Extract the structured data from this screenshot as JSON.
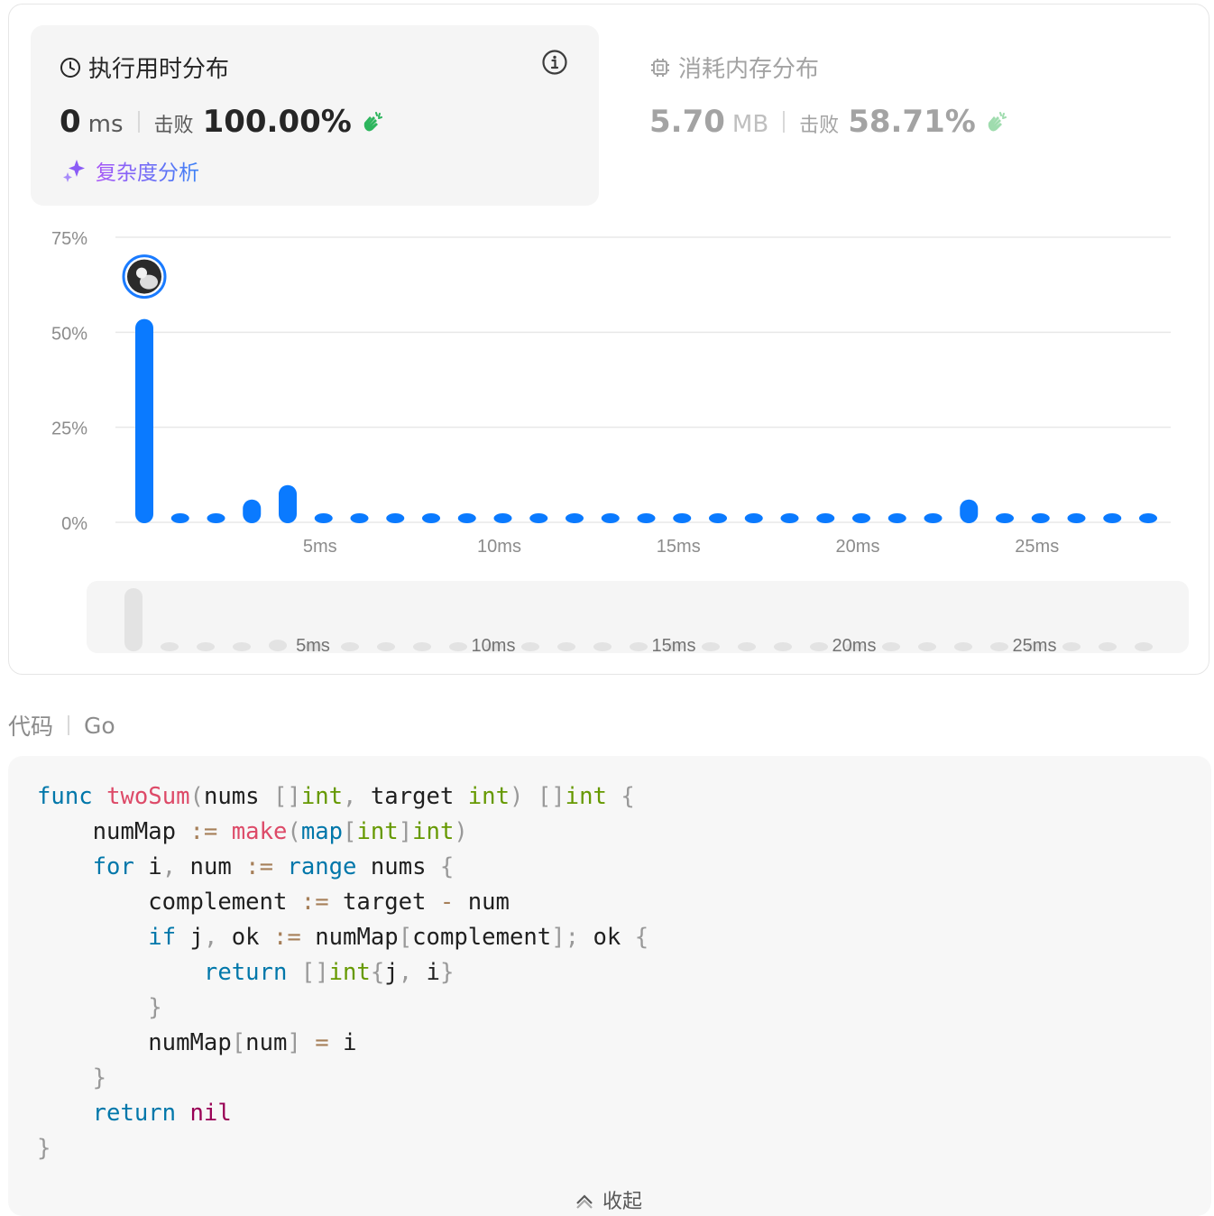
{
  "runtime": {
    "title": "执行用时分布",
    "value": "0",
    "unit": "ms",
    "beat_label": "击败",
    "beat_pct": "100.00%",
    "analysis_link": "复杂度分析"
  },
  "memory": {
    "title": "消耗内存分布",
    "value": "5.70",
    "unit": "MB",
    "beat_label": "击败",
    "beat_pct": "58.71%"
  },
  "chart_data": {
    "type": "bar",
    "y_ticks": [
      "75%",
      "50%",
      "25%",
      "0%"
    ],
    "ylim": [
      0,
      75
    ],
    "x_ticks": [
      "5ms",
      "10ms",
      "15ms",
      "20ms",
      "25ms"
    ],
    "x_tick_values": [
      5,
      10,
      15,
      20,
      25
    ],
    "x": [
      0,
      1,
      2,
      3,
      4,
      5,
      6,
      7,
      8,
      9,
      10,
      11,
      12,
      13,
      14,
      15,
      16,
      17,
      18,
      19,
      20,
      21,
      22,
      23,
      24,
      25,
      26,
      27,
      28
    ],
    "values": [
      53.5,
      1.5,
      1.5,
      6.0,
      9.8,
      1.5,
      1.5,
      1.5,
      1.5,
      1.5,
      1.5,
      1.5,
      1.5,
      1.5,
      1.5,
      1.5,
      1.5,
      1.5,
      1.5,
      1.5,
      1.5,
      1.5,
      1.5,
      6.0,
      1.5,
      1.5,
      1.5,
      1.5,
      1.5
    ],
    "highlight_index": 0,
    "bar_color": "#0a7aff",
    "grid": true
  },
  "code": {
    "label": "代码",
    "language": "Go",
    "collapse_label": "收起"
  }
}
